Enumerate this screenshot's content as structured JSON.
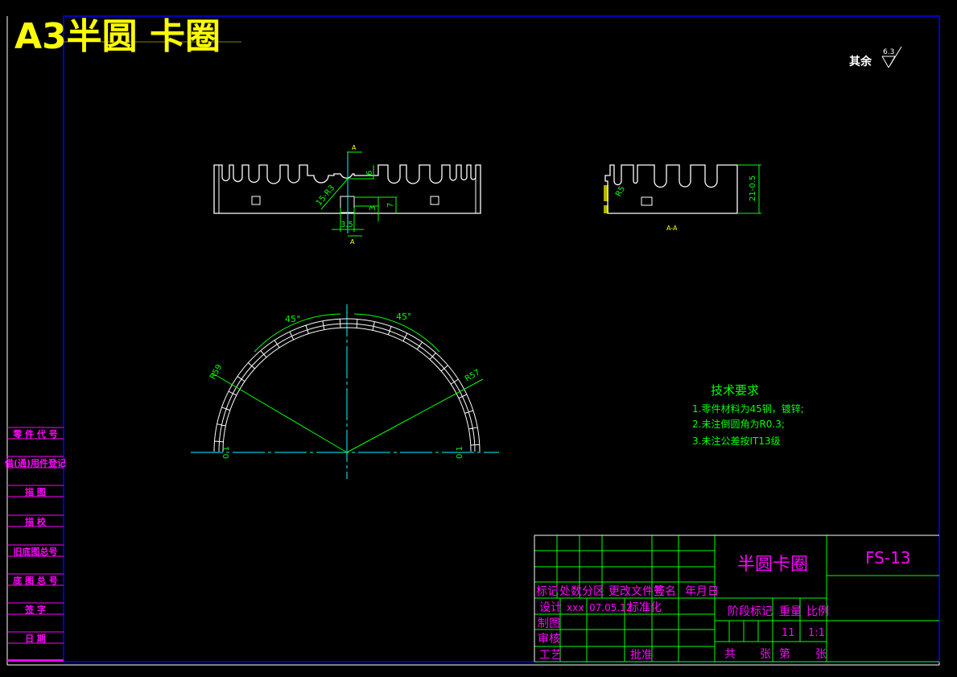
{
  "drawing_title": "A3半圆 卡圈",
  "roughness": {
    "label": "其余",
    "value": "6.3"
  },
  "front_view": {
    "section_marks": [
      "A",
      "A"
    ],
    "dims": [
      "6",
      "15-R3",
      "3",
      "7",
      "3.5"
    ]
  },
  "side_view": {
    "dims": [
      "R5",
      "21-0.5"
    ],
    "section_label": "A-A"
  },
  "arc_view": {
    "dims": [
      "45°",
      "45°",
      "R59",
      "R57",
      "0.1",
      "0.1"
    ]
  },
  "tech_requirements": {
    "title": "技术要求",
    "items": [
      "1.零件材料为45钢，镀锌;",
      "2.未注倒圆角为R0.3;",
      "3.未注公差按IT13级"
    ]
  },
  "side_strip": [
    "零 件 代 号",
    "借(通)用件登记",
    "描  图",
    "描  校",
    "旧底图总号",
    "底 图 总 号",
    "签  字",
    "日  期"
  ],
  "title_block": {
    "headers": [
      "标记",
      "处数",
      "分区",
      "更改文件号",
      "签名",
      "年月日"
    ],
    "row_labels": [
      "设计",
      "制图",
      "审核",
      "工艺"
    ],
    "designer": "xxx",
    "date": "07.05.12",
    "standardization": "标准化",
    "approve": "批准",
    "part_name": "半圆卡圈",
    "drawing_no": "FS-13",
    "stage_mark": "阶段标记",
    "weight_label": "重量",
    "scale_label": "比例",
    "weight": "11",
    "scale": "1:1",
    "total_sheets": "共",
    "sheets_unit": "张",
    "sheet_no": "第",
    "sheet_unit": "张"
  },
  "colors": {
    "background": "#000000",
    "outline": "#ffffff",
    "dimension": "#00ff00",
    "centerline": "#00ffff",
    "border": "#0000ff",
    "text": "#ff00ff",
    "title": "#ffff00"
  }
}
